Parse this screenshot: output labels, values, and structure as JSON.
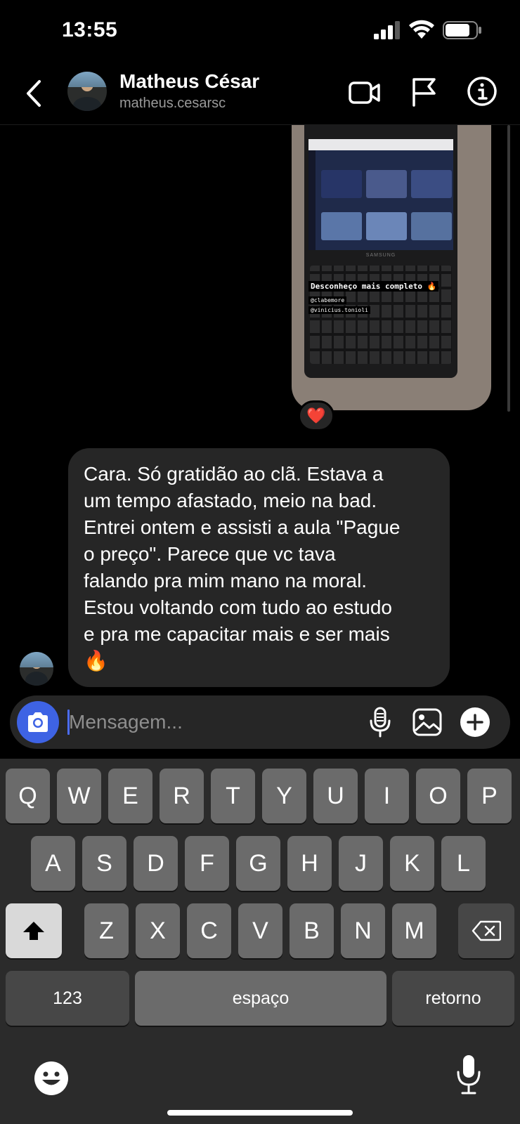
{
  "status_bar": {
    "time": "13:55"
  },
  "header": {
    "contact_name": "Matheus César",
    "contact_username": "matheus.cesarsc",
    "icons": [
      "back-icon",
      "video-call-icon",
      "flag-icon",
      "info-icon"
    ]
  },
  "shared_story": {
    "caption": "Desconheço mais completo 🔥",
    "tags": [
      "@clabemore",
      "@vinicius.tonioli"
    ],
    "laptop_brand": "SAMSUNG",
    "reaction": "❤️"
  },
  "message": {
    "text": "Cara. Só gratidão ao clã. Estava a\num tempo afastado, meio na bad.\nEntrei ontem e assisti a aula \"Pague\no preço\". Parece que vc tava\nfalando pra mim mano na moral.\nEstou voltando com tudo ao estudo\ne pra me capacitar mais e ser mais\n🔥"
  },
  "composer": {
    "placeholder": "Mensagem..."
  },
  "keyboard": {
    "row1": [
      "Q",
      "W",
      "E",
      "R",
      "T",
      "Y",
      "U",
      "I",
      "O",
      "P"
    ],
    "row2": [
      "A",
      "S",
      "D",
      "F",
      "G",
      "H",
      "J",
      "K",
      "L"
    ],
    "row3": [
      "Z",
      "X",
      "C",
      "V",
      "B",
      "N",
      "M"
    ],
    "numbers": "123",
    "space": "espaço",
    "return": "retorno"
  },
  "colors": {
    "accent": "#3e63e4",
    "bubble": "#262626",
    "reaction": "#e0243a"
  }
}
